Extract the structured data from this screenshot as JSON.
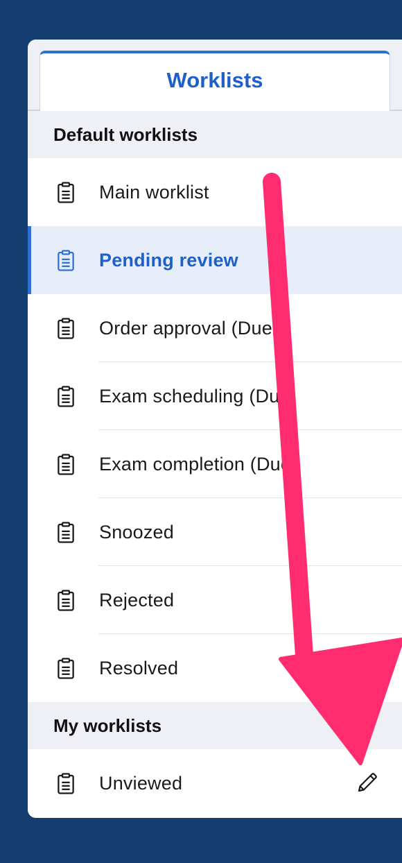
{
  "tabs": [
    {
      "label": "Worklists",
      "active": true
    }
  ],
  "sections": {
    "default": {
      "title": "Default worklists",
      "items": [
        {
          "label": "Main worklist",
          "icon": "clipboard-icon"
        },
        {
          "label": "Pending review",
          "icon": "clipboard-icon",
          "selected": true
        },
        {
          "label": "Order approval (Due",
          "icon": "clipboard-icon"
        },
        {
          "label": "Exam scheduling (Du",
          "icon": "clipboard-icon"
        },
        {
          "label": "Exam completion (Due",
          "icon": "clipboard-icon"
        },
        {
          "label": "Snoozed",
          "icon": "clipboard-icon"
        },
        {
          "label": "Rejected",
          "icon": "clipboard-icon"
        },
        {
          "label": "Resolved",
          "icon": "clipboard-icon"
        }
      ]
    },
    "mine": {
      "title": "My worklists",
      "items": [
        {
          "label": "Unviewed",
          "icon": "clipboard-icon",
          "action_icon": "pencil-icon"
        }
      ]
    }
  },
  "colors": {
    "background": "#153e70",
    "accent": "#1f5fc8",
    "selected_row": "#e8eef9",
    "section_bg": "#eef0f6",
    "annotation_arrow": "#ff2d6f"
  }
}
